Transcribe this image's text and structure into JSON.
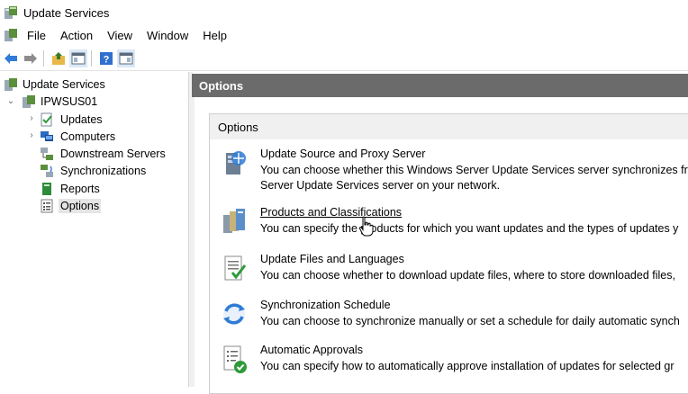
{
  "window": {
    "title": "Update Services"
  },
  "menu": [
    "File",
    "Action",
    "Window",
    "View",
    "Help"
  ],
  "menu_order": [
    "File",
    "Action",
    "View",
    "Window",
    "Help"
  ],
  "tree": {
    "root": "Update Services",
    "server": "IPWSUS01",
    "children": [
      "Updates",
      "Computers",
      "Downstream Servers",
      "Synchronizations",
      "Reports",
      "Options"
    ],
    "selected": "Options"
  },
  "pane": {
    "header": "Options"
  },
  "card": {
    "header": "Options",
    "options": [
      {
        "title": "Update Source and Proxy Server",
        "desc1": "You can choose whether this Windows Server Update Services server synchronizes fro",
        "desc2": "Server Update Services server on your network.",
        "icon": "update-source-icon"
      },
      {
        "title": "Products and Classifications",
        "desc1": "You can specify the products for which you want updates and the types of updates y",
        "icon": "products-icon"
      },
      {
        "title": "Update Files and Languages",
        "desc1": "You can choose whether to download update files, where to store downloaded files,",
        "icon": "update-files-icon"
      },
      {
        "title": "Synchronization Schedule",
        "desc1": "You can choose to synchronize manually or set a schedule for daily automatic synch",
        "icon": "sync-schedule-icon"
      },
      {
        "title": "Automatic Approvals",
        "desc1": "You can specify how to automatically approve installation of updates for selected gr",
        "icon": "auto-approvals-icon"
      }
    ]
  }
}
